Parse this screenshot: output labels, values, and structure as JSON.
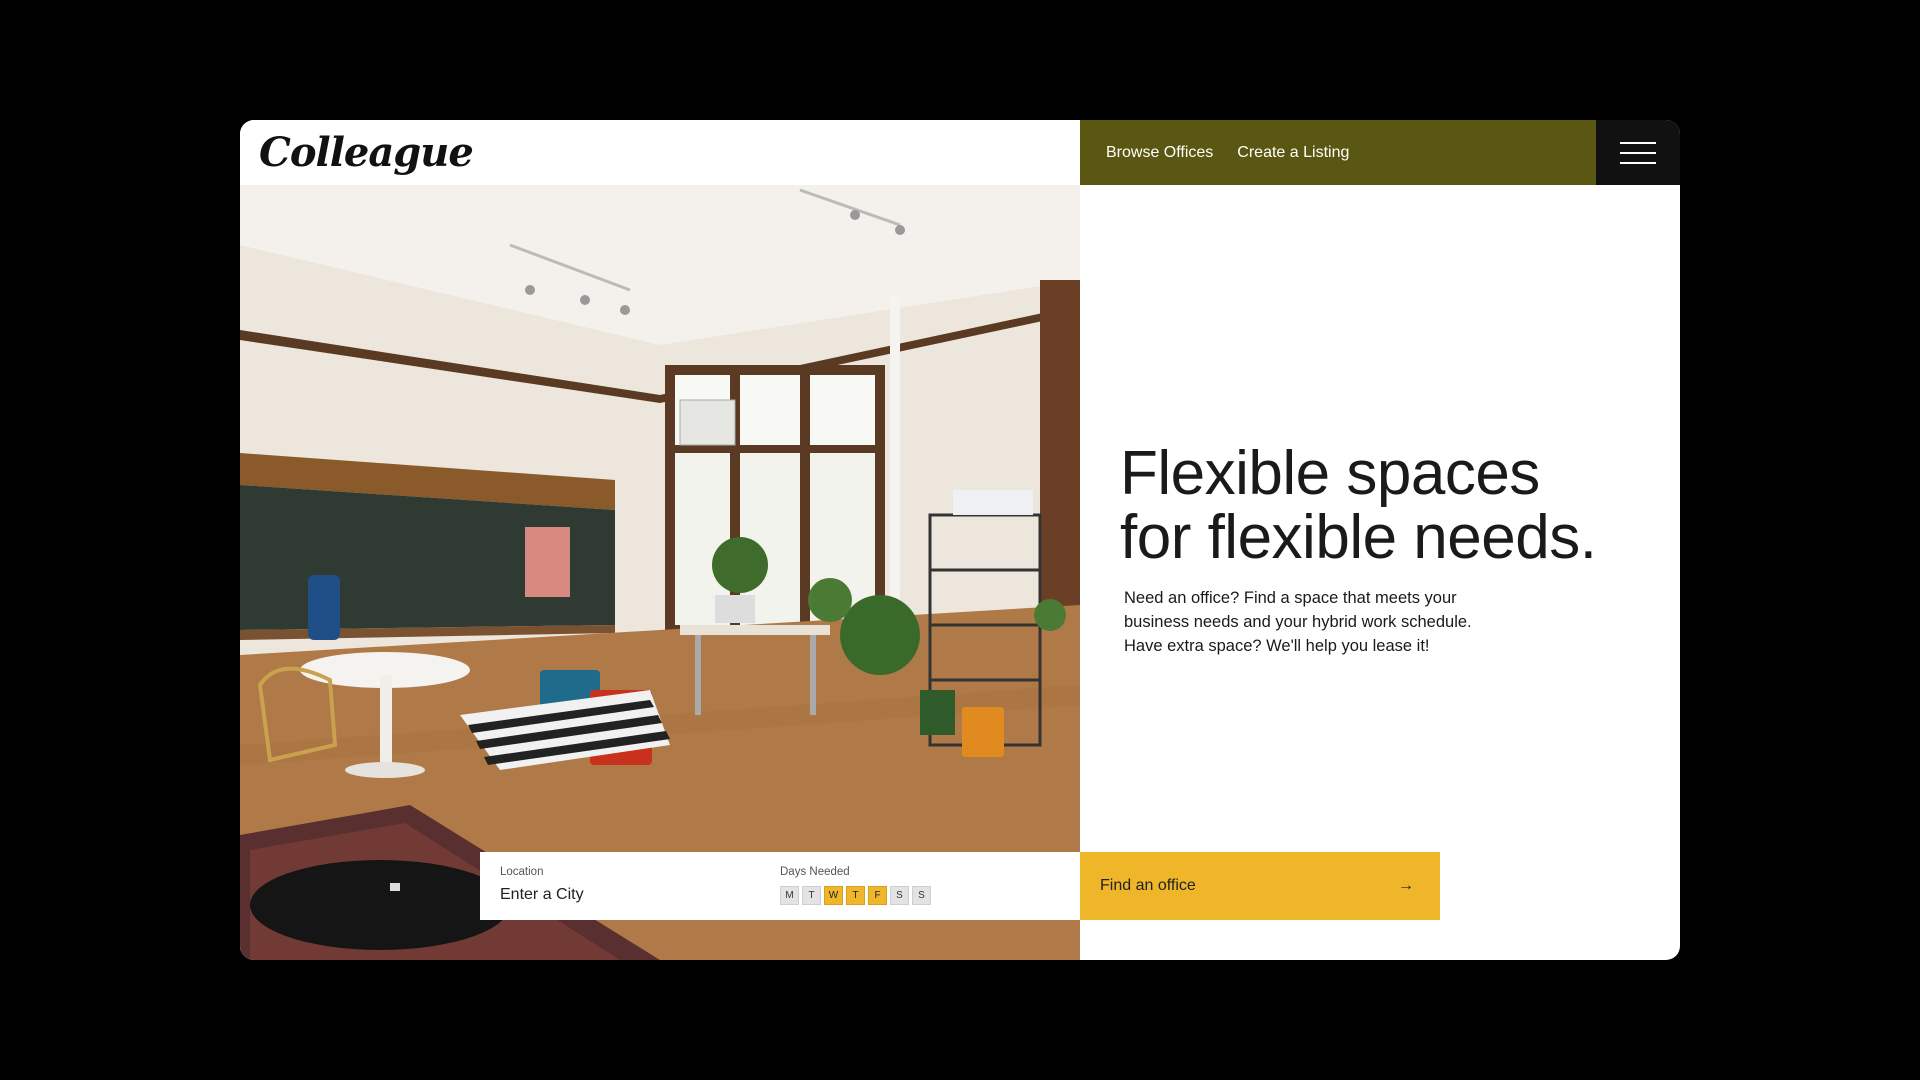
{
  "brand": {
    "logo": "Colleague"
  },
  "nav": {
    "browse": "Browse Offices",
    "create": "Create a Listing"
  },
  "hero": {
    "headline_line1": "Flexible spaces",
    "headline_line2": "for flexible needs.",
    "sub_line1": "Need an office? Find a space that meets your",
    "sub_line2": "business needs and your hybrid work schedule.",
    "sub_line3": "Have extra space? We'll help you lease it!"
  },
  "search": {
    "location_label": "Location",
    "location_placeholder": "Enter a City",
    "days_label": "Days Needed",
    "days": [
      {
        "label": "M",
        "selected": false
      },
      {
        "label": "T",
        "selected": false
      },
      {
        "label": "W",
        "selected": true
      },
      {
        "label": "T",
        "selected": true
      },
      {
        "label": "F",
        "selected": true
      },
      {
        "label": "S",
        "selected": false
      },
      {
        "label": "S",
        "selected": false
      }
    ],
    "cta": "Find an office",
    "cta_icon": "arrow-right-icon"
  },
  "colors": {
    "nav_bg": "#5a5712",
    "accent": "#f0b62a",
    "menu_bg": "#111111"
  }
}
